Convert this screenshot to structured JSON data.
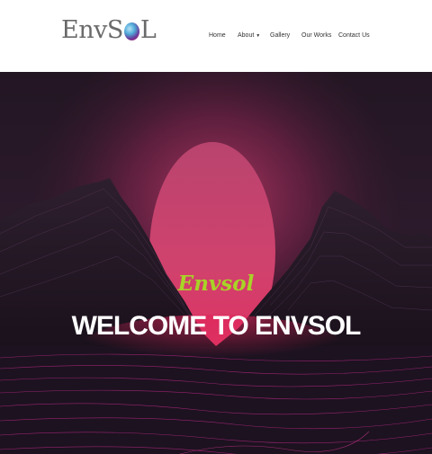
{
  "brand": {
    "logo_text": "EnvSOL"
  },
  "nav": {
    "items": [
      {
        "label": "Home"
      },
      {
        "label": "About",
        "has_dropdown": true
      },
      {
        "label": "Gallery"
      },
      {
        "label": "Our Works"
      },
      {
        "label": "Contact Us"
      }
    ]
  },
  "hero": {
    "subtitle": "Envsol",
    "title": "WELCOME TO ENVSOL"
  },
  "colors": {
    "accent_green": "#a8d327",
    "sun_pink": "#c83c6c",
    "grid_magenta": "#c02a8a"
  }
}
